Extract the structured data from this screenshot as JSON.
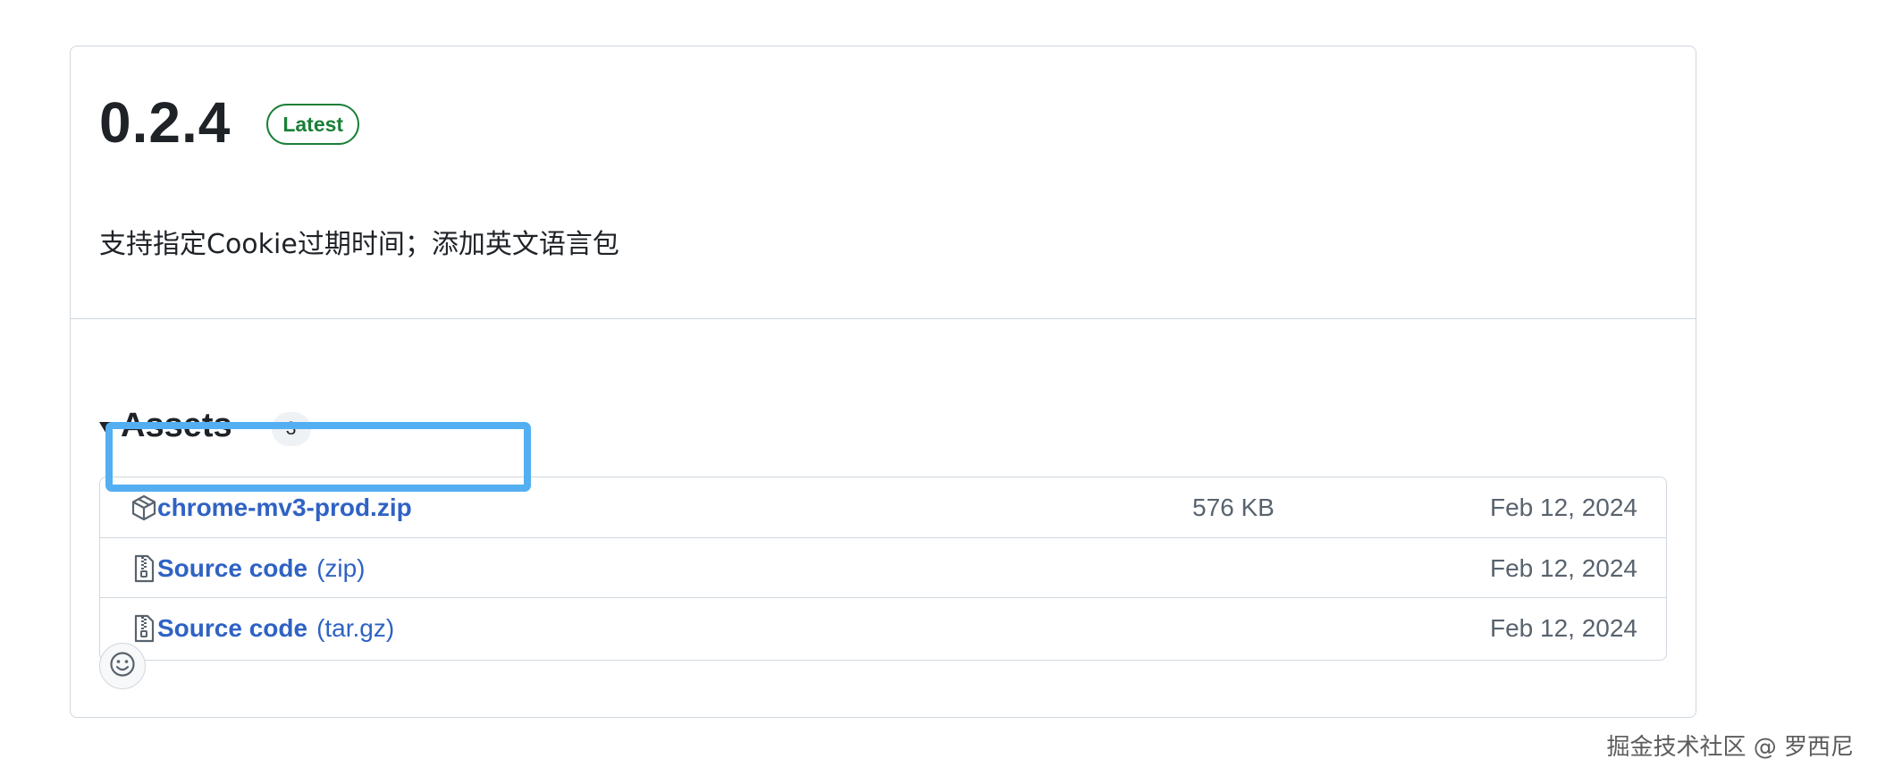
{
  "release": {
    "version": "0.2.4",
    "badge": "Latest",
    "notes": "支持指定Cookie过期时间；添加英文语言包"
  },
  "assets": {
    "title": "Assets",
    "count": "3",
    "items": [
      {
        "icon": "package-icon",
        "name": "chrome-mv3-prod.zip",
        "suffix": "",
        "size": "576 KB",
        "date": "Feb 12, 2024"
      },
      {
        "icon": "file-zip-icon",
        "name": "Source code",
        "suffix": "(zip)",
        "size": "",
        "date": "Feb 12, 2024"
      },
      {
        "icon": "file-zip-icon",
        "name": "Source code",
        "suffix": "(tar.gz)",
        "size": "",
        "date": "Feb 12, 2024"
      }
    ]
  },
  "reactions": {
    "icon": "smiley-icon"
  },
  "watermark": "掘金技术社区 @ 罗西尼",
  "colors": {
    "link": "#2f62c4",
    "latest_badge": "#1a7f37",
    "highlight": "#53aff2",
    "border": "#d0d7de",
    "muted_text": "#59636e"
  }
}
